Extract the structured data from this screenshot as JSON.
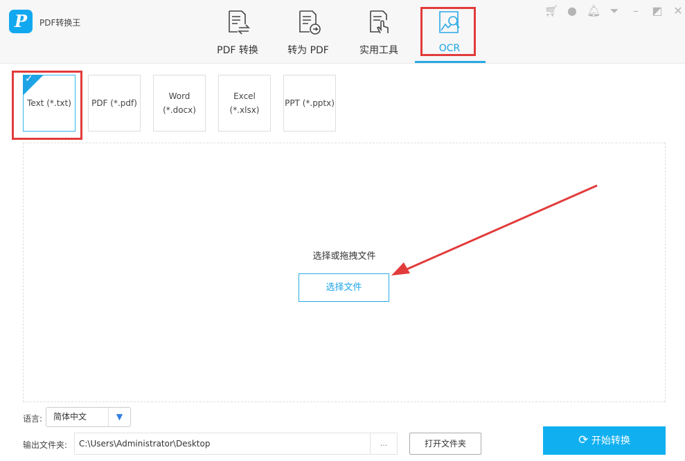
{
  "app": {
    "title": "PDF转换王",
    "logo_letter": "P"
  },
  "tabs": [
    {
      "label": "PDF 转换"
    },
    {
      "label": "转为 PDF"
    },
    {
      "label": "实用工具"
    },
    {
      "label": "OCR",
      "active": true
    }
  ],
  "window_icons": [
    "cart-icon",
    "user-icon",
    "bell-icon",
    "dropdown-menu-icon",
    "minimize-icon",
    "restore-icon",
    "close-icon"
  ],
  "formats": [
    {
      "label": "Text (*.txt)",
      "selected": true
    },
    {
      "label": "PDF (*.pdf)"
    },
    {
      "label": "Word\n(*.docx)"
    },
    {
      "label": "Excel (*.xlsx)"
    },
    {
      "label": "PPT (*.pptx)"
    }
  ],
  "dropzone": {
    "text": "选择或拖拽文件",
    "button": "选择文件"
  },
  "language": {
    "label": "语言:",
    "value": "简体中文",
    "arrow": "▼"
  },
  "output": {
    "label": "输出文件夹:",
    "path": "C:\\Users\\Administrator\\Desktop",
    "browse": "...",
    "open_folder": "打开文件夹"
  },
  "start": {
    "label": "开始转换"
  },
  "colors": {
    "accent": "#10b0f0",
    "highlight": "#e23b3b"
  }
}
